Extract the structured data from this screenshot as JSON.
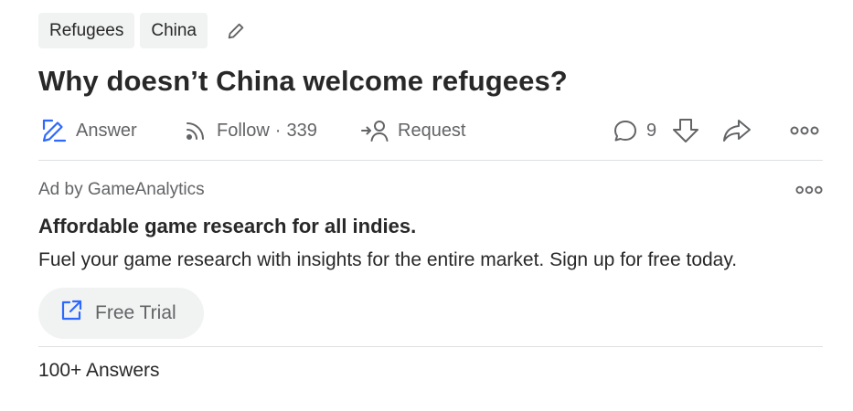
{
  "topics": [
    "Refugees",
    "China"
  ],
  "question": {
    "title": "Why doesn’t China welcome refugees?"
  },
  "actions": {
    "answer_label": "Answer",
    "follow_label": "Follow",
    "follow_sep": "·",
    "follow_count": "339",
    "request_label": "Request",
    "comment_count": "9"
  },
  "ad": {
    "by": "Ad by GameAnalytics",
    "title": "Affordable game research for all indies.",
    "body": "Fuel your game research with insights for the entire market. Sign up for free today.",
    "cta_label": "Free Trial"
  },
  "answers_count": "100+ Answers",
  "colors": {
    "accent_blue": "#2e69ff",
    "text_primary": "#282829",
    "text_secondary": "#636466",
    "chip_bg": "#f1f2f2",
    "divider": "#dee0e1"
  },
  "icons": [
    "pencil-icon",
    "answer-icon",
    "follow-icon",
    "request-icon",
    "comment-icon",
    "downvote-icon",
    "share-icon",
    "more-icon"
  ]
}
